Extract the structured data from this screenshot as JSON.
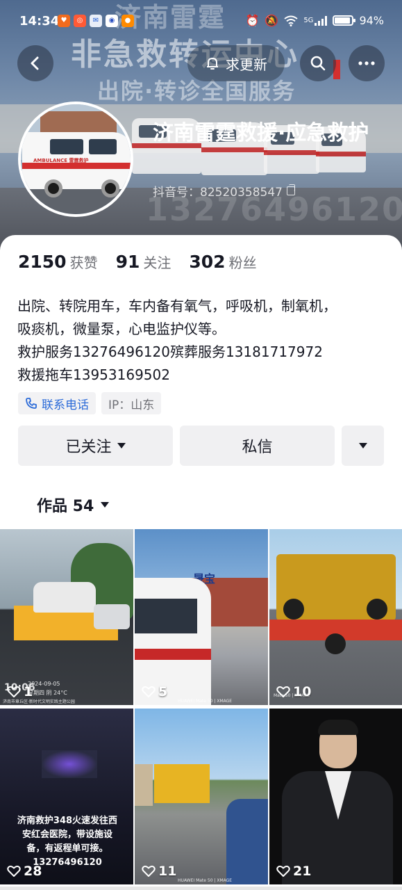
{
  "status_bar": {
    "time": "14:34",
    "battery": "94%",
    "network": "5G"
  },
  "cover": {
    "watermark_top": "济南雷霆",
    "watermark_main": "非急救转运中心",
    "watermark_sub": "出院·转诊全国服务",
    "watermark_phone": "13276496120"
  },
  "nav": {
    "update_label": "求更新",
    "back_icon": "chevron-left-icon",
    "search_icon": "search-icon",
    "more_icon": "more-icon"
  },
  "avatar": {
    "ambulance_text": "AMBULANCE 雷霆救护"
  },
  "profile": {
    "name": "济南雷霆救援·应急救护",
    "douyin_id": "抖音号：82520358547"
  },
  "stats": [
    {
      "num": "2150",
      "label": "获赞"
    },
    {
      "num": "91",
      "label": "关注"
    },
    {
      "num": "302",
      "label": "粉丝"
    }
  ],
  "bio": "出院、转院用车，车内备有氧气，呼吸机，制氧机，\n吸痰机，微量泵，心电监护仪等。\n救护服务13276496120殡葬服务13181717972\n救援拖车13953169502",
  "tags": {
    "phone": "联系电话",
    "ip": "IP：山东"
  },
  "actions": {
    "follow": "已关注",
    "message": "私信"
  },
  "works": {
    "label": "作品 54"
  },
  "grid": [
    {
      "likes": "1",
      "caption_date": "2024-09-05",
      "caption_time": "10:06",
      "caption_weather": "星期四 阴 24°C",
      "caption_loc": "济南市章丘区·新时代文明实践主题公园"
    },
    {
      "likes": "5",
      "sign": "晟宝",
      "watermark": "HUAWEI Mate 50 | XMAGE"
    },
    {
      "likes": "10",
      "watermark": "Mate 50 | XMAGE"
    },
    {
      "likes": "28",
      "overlay_line1": "济南救护348火速发往西",
      "overlay_line2": "安红会医院，带设施设",
      "overlay_line3": "备，有返程单可接。",
      "overlay_phone": "13276496120"
    },
    {
      "likes": "11",
      "watermark": "HUAWEI Mate 50 | XMAGE"
    },
    {
      "likes": "21"
    }
  ]
}
